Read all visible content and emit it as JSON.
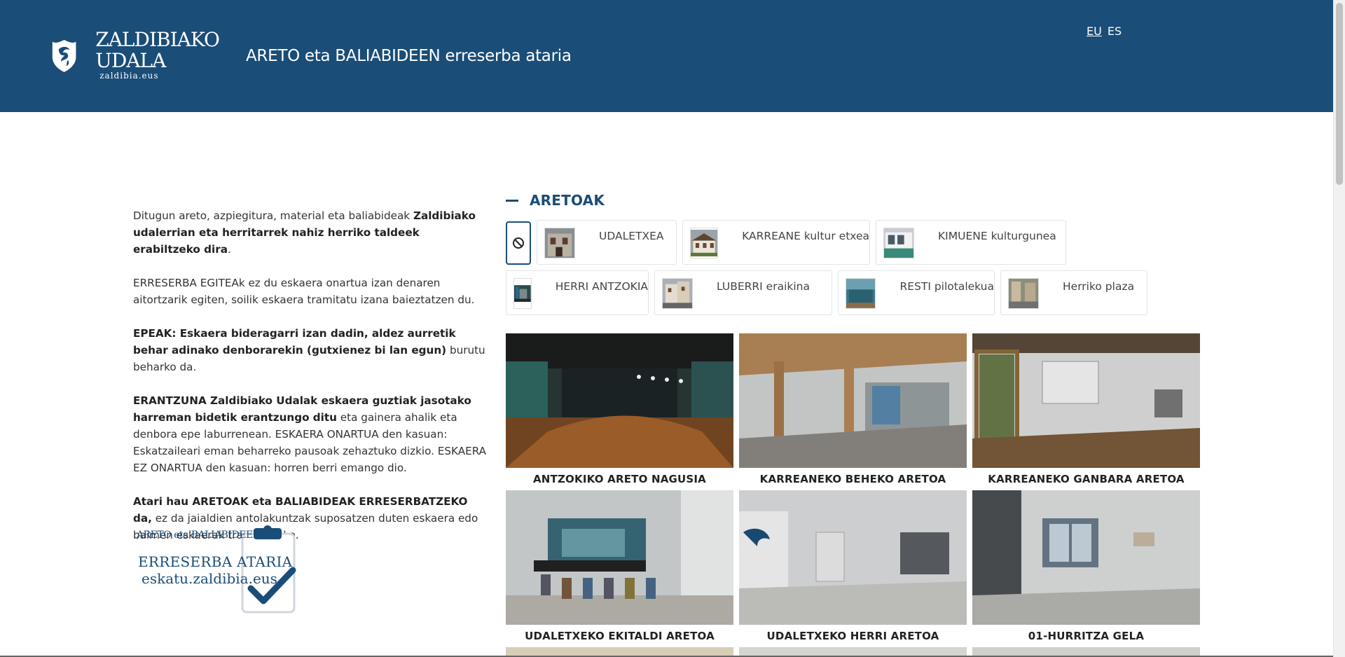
{
  "header": {
    "logo_line1": "ZALDIBIAKO",
    "logo_line2": "UDALA",
    "logo_sub": "zaldibia.eus",
    "title": "ARETO eta BALIABIDEEN erreserba ataria",
    "languages": [
      "EU",
      "ES"
    ],
    "active_language": "EU"
  },
  "intro": {
    "p1_a": "Ditugun areto, azpiegitura, material eta baliabideak ",
    "p1_b": "Zaldibiako udalerrian eta herritarrek nahiz herriko taldeek erabiltzeko dira",
    "p1_c": ".",
    "p2": "ERRESERBA EGITEAk ez du eskaera onartua izan denaren aitortzarik egiten, soilik eskaera tramitatu izana baieztatzen du.",
    "p3_a": "EPEAK: Eskaera bideragarri izan dadin, aldez aurretik behar adinako denborarekin (gutxienez bi lan egun)",
    "p3_b": " burutu beharko da.",
    "p4_a": "ERANTZUNA Zaldibiako Udalak eskaera guztiak jasotako harreman bidetik erantzungo ditu",
    "p4_b": " eta gainera ahalik eta denbora epe laburrenean. ESKAERA ONARTUA den kasuan: Eskatzaileari eman beharreko pausoak zehaztuko dizkio. ESKAERA EZ ONARTUA den kasuan: horren berri emango dio.",
    "p5_a": "Atari hau ARETOAK eta BALIABIDEAK ERRESERBATZEKO da,",
    "p5_b": " ez da jaialdien antolakuntzak suposatzen duten eskaera edo baimen eskaerak tramitatzeko."
  },
  "badge": {
    "top": "ARETO eta BALIABIDEEN",
    "main": "ERRESERBA ATARIA",
    "url": "eskatu.zaldibia.eus"
  },
  "section": {
    "title": "ARETOAK"
  },
  "filters": [
    {
      "label": "UDALETXEA"
    },
    {
      "label": "KARREANE kultur etxea"
    },
    {
      "label": "KIMUENE kulturgunea"
    },
    {
      "label": "HERRI ANTZOKIA"
    },
    {
      "label": "LUBERRI eraikina"
    },
    {
      "label": "RESTI pilotalekua"
    },
    {
      "label": "Herriko plaza"
    }
  ],
  "rooms": [
    {
      "label": "ANTZOKIKO ARETO NAGUSIA"
    },
    {
      "label": "KARREANEKO BEHEKO ARETOA"
    },
    {
      "label": "KARREANEKO GANBARA ARETOA"
    },
    {
      "label": "UDALETXEKO EKITALDI ARETOA"
    },
    {
      "label": "UDALETXEKO HERRI ARETOA"
    },
    {
      "label": "01-HURRITZA GELA"
    }
  ],
  "colors": {
    "brand": "#1a4d78",
    "text": "#333333"
  }
}
